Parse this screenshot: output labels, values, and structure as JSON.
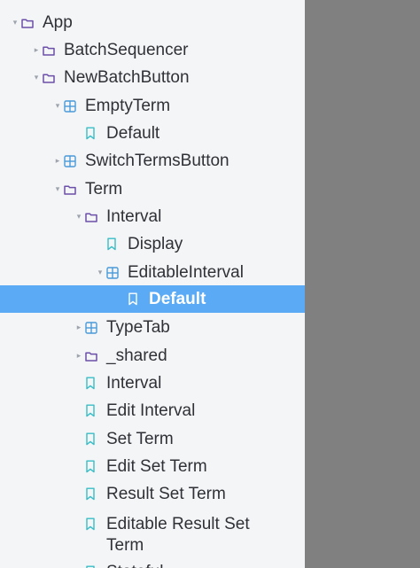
{
  "tree": {
    "rows": [
      {
        "label": "App",
        "icon": "folder-icon",
        "caret": "expanded",
        "level": 0
      },
      {
        "label": "BatchSequencer",
        "icon": "folder-icon",
        "caret": "collapsed",
        "level": 1
      },
      {
        "label": "NewBatchButton",
        "icon": "folder-icon",
        "caret": "expanded",
        "level": 1
      },
      {
        "label": "EmptyTerm",
        "icon": "component-icon",
        "caret": "expanded",
        "level": 2
      },
      {
        "label": "Default",
        "icon": "bookmark-icon",
        "caret": "none",
        "level": 3
      },
      {
        "label": "SwitchTermsButton",
        "icon": "component-icon",
        "caret": "collapsed",
        "level": 2
      },
      {
        "label": "Term",
        "icon": "folder-icon",
        "caret": "expanded",
        "level": 2
      },
      {
        "label": "Interval",
        "icon": "folder-icon",
        "caret": "expanded",
        "level": 3
      },
      {
        "label": "Display",
        "icon": "bookmark-icon",
        "caret": "none",
        "level": 4
      },
      {
        "label": "EditableInterval",
        "icon": "component-icon",
        "caret": "expanded",
        "level": 4
      },
      {
        "label": "Default",
        "icon": "bookmark-icon",
        "caret": "none",
        "level": 5,
        "selected": true
      },
      {
        "label": "TypeTab",
        "icon": "component-icon",
        "caret": "collapsed",
        "level": 3
      },
      {
        "label": "_shared",
        "icon": "folder-icon",
        "caret": "collapsed",
        "level": 3
      },
      {
        "label": "Interval",
        "icon": "bookmark-icon",
        "caret": "none",
        "level": 3
      },
      {
        "label": "Edit Interval",
        "icon": "bookmark-icon",
        "caret": "none",
        "level": 3
      },
      {
        "label": "Set Term",
        "icon": "bookmark-icon",
        "caret": "none",
        "level": 3
      },
      {
        "label": "Edit Set Term",
        "icon": "bookmark-icon",
        "caret": "none",
        "level": 3
      },
      {
        "label": "Result Set Term",
        "icon": "bookmark-icon",
        "caret": "none",
        "level": 3
      },
      {
        "label": "Editable Result Set Term",
        "icon": "bookmark-icon",
        "caret": "none",
        "level": 3
      },
      {
        "label": "Stateful",
        "icon": "bookmark-icon",
        "caret": "none",
        "level": 3
      }
    ]
  },
  "colors": {
    "folder": "#6b4fa8",
    "component": "#4a9ad8",
    "bookmark": "#37bdc6",
    "selected_bg": "#5aaaf5",
    "selected_icon": "#ffffff"
  }
}
